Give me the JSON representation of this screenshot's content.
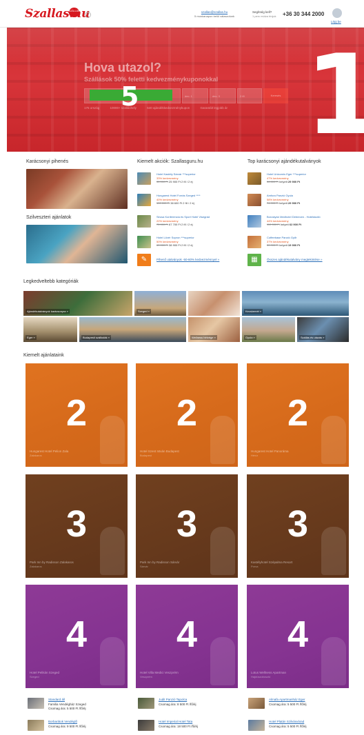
{
  "header": {
    "logo": "Szallas.hu",
    "heart_label": "SZÁLLÁS",
    "help_icon": "?",
    "email": "szallas@szallas.hu",
    "email_sub": "5 munkanapon belül válaszolunk",
    "help_title": "Segítség kell?",
    "help_sub": "1 perc múlva hívjuk",
    "phone": "+36 30 344 2000",
    "login": "Lépj be"
  },
  "hero": {
    "title": "Hova utazol?",
    "subtitle": "Szállások 50% feletti kedvezménykuponokkal",
    "search_fields": [
      "",
      "dec. 1",
      "dec. 3",
      "2 fő",
      "Keresés"
    ],
    "search_button": "Keresés",
    "stats": [
      "175 ország",
      "10000+ szálláshely",
      "640 ajándékkedvezménykupon",
      "Garantált legjobb ár"
    ],
    "overlay_num": "1",
    "overlay_num_search": "5"
  },
  "col1": {
    "title": "Karácsonyi pihenés",
    "title2": "Szilveszteri ajánlatok"
  },
  "col2": {
    "title": "Kiemelt akciók: Szallasguru.hu",
    "items": [
      {
        "name": "Hotel Kastély Sárvár ***superior",
        "disc": "33% kedvezmény",
        "price": "25 900 Ft 2 fő / 2 éj",
        "old": "35 000 Ft"
      },
      {
        "name": "Hungarest Hotel Forrás Szeged ****",
        "disc": "40% kedvezmény",
        "price": "38 600 Ft 2 fő / 2 éj",
        "old": "100 000 Ft"
      },
      {
        "name": "Sirusa Konferencia és Sport Hotel Visegrád",
        "disc": "22% kedvezmény",
        "price": "67 700 Ft 2 fő / 2 éj",
        "old": "75 000 Ft"
      },
      {
        "name": "Hotel Lövér Sopron ***superior",
        "disc": "50% kedvezmény",
        "price": "38 900 Ft 2 fő / 2 éj",
        "old": "60 000 Ft"
      }
    ],
    "link": "Pihenő utalványok -50-60% kedvezménnyel »"
  },
  "col3": {
    "title": "Top karácsonyi ajándékutalványok",
    "items": [
      {
        "name": "Hotel Unicornis Eger ***superior",
        "disc": "47% kedvezmény",
        "price": "29 900 Ft",
        "old": "56 800 Ft"
      },
      {
        "name": "Amfora Panzió Gyula",
        "disc": "58% kedvezmény",
        "price": "29 900 Ft",
        "old": "74 000 Ft"
      },
      {
        "name": "Borostyán Medhotel Debrecen - Hotelstudió",
        "disc": "44% kedvezmény",
        "price": "62 900 Ft",
        "old": "110 000 Ft"
      },
      {
        "name": "Coffeebase Panzió Győr",
        "disc": "37% kedvezmény",
        "price": "19 900 Ft",
        "old": "30 000 Ft"
      }
    ],
    "link": "Összes ajándékutalvány megtekintése »"
  },
  "categories": {
    "title": "Legkedveltebb kategóriák",
    "row1": [
      "Ajándékutalványok karácsonyra »",
      "Szeged »",
      "",
      "Kecskemét »"
    ],
    "row2": [
      "Eger »",
      "Budapesti szállodák »",
      "Wellness hétvége »",
      "Gyula »",
      "Szállás és utazás »"
    ]
  },
  "featured": {
    "title": "Kiemelt ajánlataink",
    "rows": [
      {
        "num": "2",
        "items": [
          {
            "name": "Hungarest Hotel Pelion Zala",
            "sub": "Zalakaros"
          },
          {
            "name": "Hotel Szent István Budapest",
            "sub": "Budapest"
          },
          {
            "name": "Hungarest Hotel Panoráma",
            "sub": "Hévíz"
          }
        ]
      },
      {
        "num": "3",
        "items": [
          {
            "name": "Park Inn by Radisson Zalakaros",
            "sub": "Zalakaros"
          },
          {
            "name": "Park Inn by Radisson Sárvár",
            "sub": "Sárvár"
          },
          {
            "name": "Kastélyhotel Szépalma Resort",
            "sub": "Porva"
          }
        ]
      },
      {
        "num": "4",
        "items": [
          {
            "name": "Hotel Pelikán Szeged",
            "sub": "Szeged"
          },
          {
            "name": "Hotel Villa Medici Veszprém",
            "sub": "Veszprém"
          },
          {
            "name": "Lotus Wellness Apartman",
            "sub": "Hajdúszoboszló"
          }
        ]
      }
    ]
  },
  "listings": [
    {
      "name": "Standard áll",
      "desc": "Familia Vendégház Szeged",
      "price": "Csomag ára: 5 500 Ft /fő/éj"
    },
    {
      "name": "Judit Panzió Tapolca",
      "desc": "",
      "price": "Csomag ára: 8 500 Ft /fő/éj"
    },
    {
      "name": "Almafa Apartmanház Eger",
      "desc": "",
      "price": "Csomag ára: 5 500 Ft /fő/éj"
    },
    {
      "name": "Borbarátok Vendéglő",
      "desc": "",
      "price": "Csomag ára: 9 500 Ft /fő/éj"
    },
    {
      "name": "Hotel Imperial Hotel Tata",
      "desc": "",
      "price": "Csomag ára: 18 500 Ft /fő/éj"
    },
    {
      "name": "Hotel Platán Szilvásvárad",
      "desc": "",
      "price": "Csomag ára: 5 500 Ft /fő/éj"
    }
  ]
}
